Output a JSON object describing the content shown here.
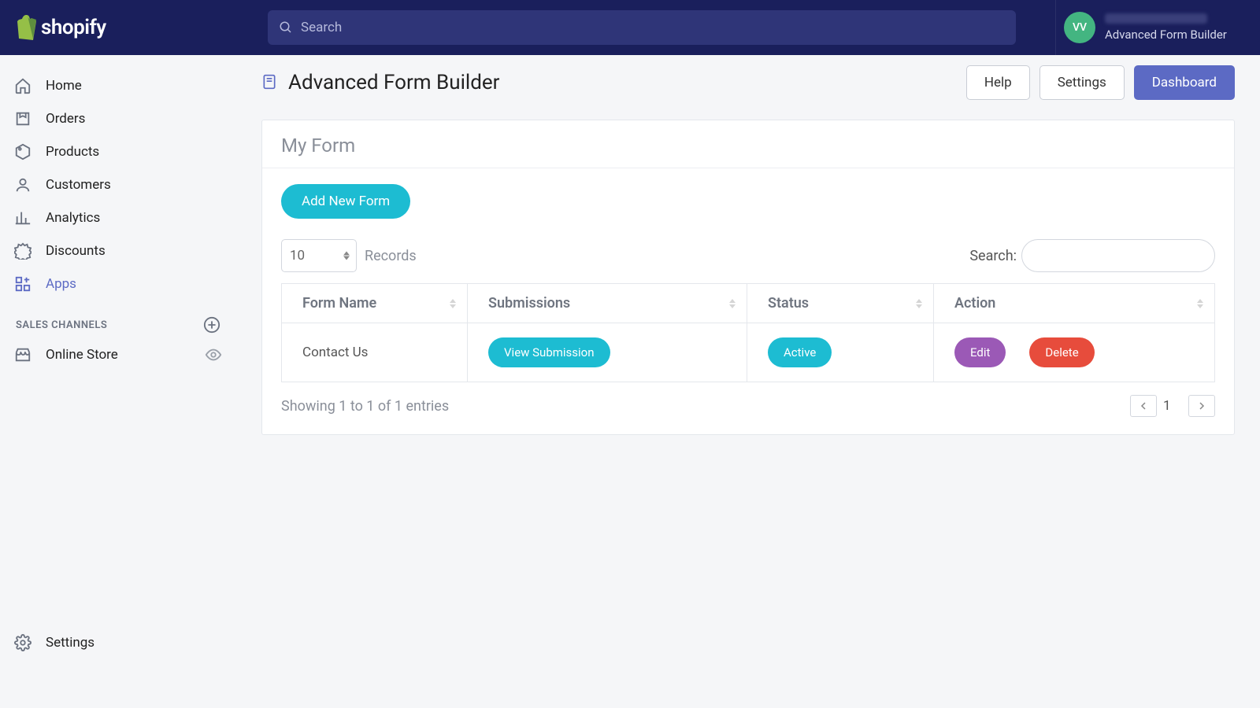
{
  "brand": "shopify",
  "search": {
    "placeholder": "Search"
  },
  "user": {
    "initials": "VV",
    "subtitle": "Advanced Form Builder"
  },
  "nav": {
    "home": "Home",
    "orders": "Orders",
    "products": "Products",
    "customers": "Customers",
    "analytics": "Analytics",
    "discounts": "Discounts",
    "apps": "Apps"
  },
  "channels": {
    "label": "SALES CHANNELS",
    "online_store": "Online Store"
  },
  "settings_label": "Settings",
  "page": {
    "title": "Advanced Form Builder"
  },
  "header_buttons": {
    "help": "Help",
    "settings": "Settings",
    "dashboard": "Dashboard"
  },
  "card": {
    "title": "My Form",
    "add_btn": "Add New Form",
    "records_value": "10",
    "records_label": "Records",
    "search_label": "Search:",
    "columns": {
      "name": "Form Name",
      "submissions": "Submissions",
      "status": "Status",
      "action": "Action"
    },
    "rows": [
      {
        "name": "Contact Us",
        "view_label": "View Submission",
        "status_label": "Active",
        "edit_label": "Edit",
        "delete_label": "Delete"
      }
    ],
    "footer": "Showing 1 to 1 of 1 entries",
    "page_num": "1"
  }
}
